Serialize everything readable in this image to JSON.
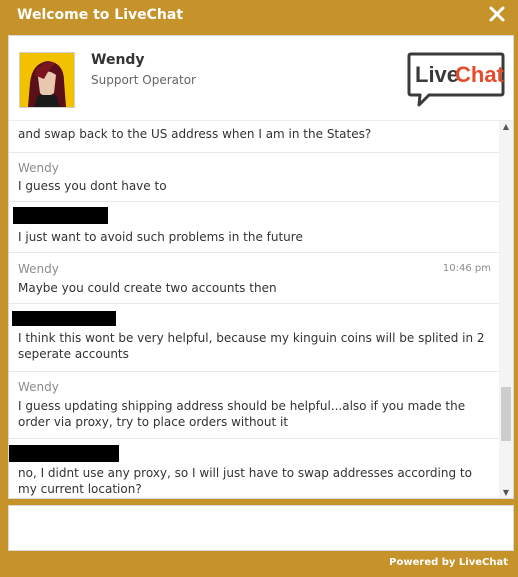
{
  "window": {
    "title": "Welcome to LiveChat"
  },
  "agent": {
    "name": "Wendy",
    "role": "Support Operator"
  },
  "logo": {
    "text_live": "Live",
    "text_chat": "Chat"
  },
  "messages": [
    {
      "author": "",
      "time": "",
      "text": "and swap back to the US address when I am in the States?"
    },
    {
      "author": "Wendy",
      "time": "",
      "text": "I guess you dont have to"
    },
    {
      "author": "",
      "time": "",
      "text": "I just want to avoid such problems in the future"
    },
    {
      "author": "Wendy",
      "time": "10:46 pm",
      "text": "Maybe you could create two accounts then"
    },
    {
      "author": "",
      "time": "",
      "text": "I think this wont be very helpful, because my kinguin coins will be splited in 2 seperate accounts"
    },
    {
      "author": "Wendy",
      "time": "",
      "text": "I guess updating shipping address should be helpful...also if you made the order via proxy, try to place orders without it"
    },
    {
      "author": "",
      "time": "",
      "text": "no, I didnt use any proxy, so I will just have to swap addresses according to my current location?"
    }
  ],
  "footer": {
    "powered_by": "Powered by LiveChat"
  },
  "colors": {
    "frame": "#c6922a",
    "logo_red": "#e44c2c",
    "logo_dark": "#3a3a3a"
  }
}
